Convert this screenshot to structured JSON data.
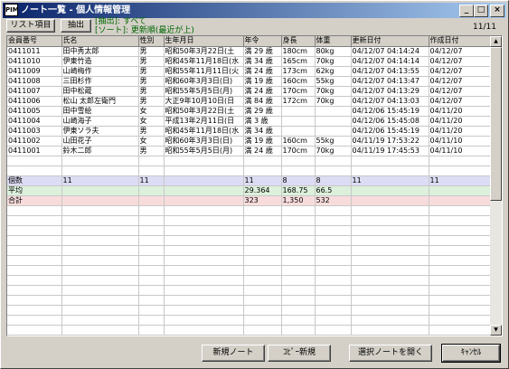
{
  "window": {
    "title": "ノート一覧 - 個人情報管理",
    "icon_text": "PIM",
    "minimize": "_",
    "maximize": "□",
    "close": "×"
  },
  "toolbar": {
    "list_items_label": "リスト項目",
    "extract_label": "抽出",
    "filter_line1": "[抽出]: すべて",
    "filter_line2": "[ソート]: 更新順(最近が上)",
    "record_count": "11/11"
  },
  "table": {
    "columns": [
      "会員番号",
      "氏名",
      "性別",
      "生年月日",
      "年令",
      "身長",
      "体重",
      "更新日付",
      "作成日付"
    ],
    "rows": [
      [
        "0411011",
        "田中秀太郎",
        "男",
        "昭和50年3月22日(土",
        "満 29 歳",
        "180cm",
        "80kg",
        "04/12/07 04:14:24",
        "04/12/07"
      ],
      [
        "0411010",
        "伊東竹造",
        "男",
        "昭和45年11月18日(水",
        "満 34 歳",
        "165cm",
        "70kg",
        "04/12/07 04:14:14",
        "04/12/07"
      ],
      [
        "0411009",
        "山崎梅作",
        "男",
        "昭和55年11月11日(火",
        "満 24 歳",
        "173cm",
        "62kg",
        "04/12/07 04:13:55",
        "04/12/07"
      ],
      [
        "0411008",
        "三田杉作",
        "男",
        "昭和60年3月3日(日)",
        "満 19 歳",
        "160cm",
        "55kg",
        "04/12/07 04:13:47",
        "04/12/07"
      ],
      [
        "0411007",
        "田中松蔵",
        "男",
        "昭和55年5月5日(月)",
        "満 24 歳",
        "170cm",
        "70kg",
        "04/12/07 04:13:29",
        "04/12/07"
      ],
      [
        "0411006",
        "松山 太郎左衛門",
        "男",
        "大正9年10月10日(日",
        "満 84 歳",
        "172cm",
        "70kg",
        "04/12/07 04:13:03",
        "04/12/07"
      ],
      [
        "0411005",
        "田中雪絵",
        "女",
        "昭和50年3月22日(土",
        "満 29 歳",
        "",
        "",
        "04/12/06 15:45:19",
        "04/11/20"
      ],
      [
        "0411004",
        "山崎海子",
        "女",
        "平成13年2月11日(日",
        "満 3 歳",
        "",
        "",
        "04/12/06 15:45:08",
        "04/11/20"
      ],
      [
        "0411003",
        "伊東ソラ夫",
        "男",
        "昭和45年11月18日(水",
        "満 34 歳",
        "",
        "",
        "04/12/06 15:45:19",
        "04/11/20"
      ],
      [
        "0411002",
        "山田花子",
        "女",
        "昭和60年3月3日(日)",
        "満 19 歳",
        "160cm",
        "55kg",
        "04/11/19 17:53:22",
        "04/11/10"
      ],
      [
        "0411001",
        "鈴木二郎",
        "男",
        "昭和55年5月5日(月)",
        "満 24 歳",
        "170cm",
        "70kg",
        "04/11/19 17:45:53",
        "04/11/10"
      ]
    ],
    "summary": [
      [
        "個数",
        "11",
        "11",
        "",
        "11",
        "8",
        "8",
        "11",
        "11"
      ],
      [
        "平均",
        "",
        "",
        "",
        "29.364",
        "168.75",
        "66.5",
        "",
        ""
      ],
      [
        "合計",
        "",
        "",
        "",
        "323",
        "1,350",
        "532",
        "",
        ""
      ]
    ]
  },
  "footer": {
    "new_note_label": "新規ノート",
    "copy_new_label": "ｺﾋﾟｰ新規",
    "open_selected_label": "選択ノートを開く",
    "cancel_label": "ｷｬﾝｾﾙ"
  },
  "scrollbar": {
    "up": "▲",
    "down": "▼"
  }
}
